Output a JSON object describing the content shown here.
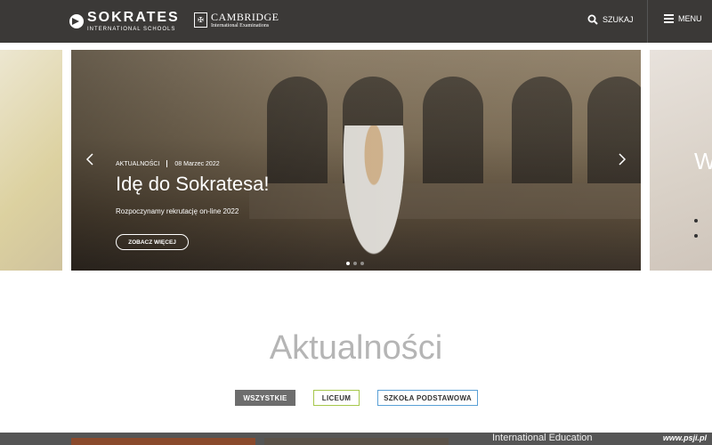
{
  "header": {
    "logo_name": "SOKRATES",
    "logo_sub": "INTERNATIONAL SCHOOLS",
    "cambridge_name": "CAMBRIDGE",
    "cambridge_sub": "International Examinations",
    "search_label": "SZUKAJ",
    "menu_label": "MENU"
  },
  "slider": {
    "category": "AKTUALNOŚCI",
    "date": "08 Marzec 2022",
    "title": "Idę do Sokratesa!",
    "subtitle": "Rozpoczynamy rekrutację on-line 2022",
    "button": "ZOBACZ WIĘCEJ",
    "right_peek_letter": "W",
    "active_dot": 1,
    "dot_count": 3
  },
  "section": {
    "title": "Aktualności",
    "filters": [
      "WSZYSTKIE",
      "LICEUM",
      "SZKOŁA PODSTAWOWA"
    ]
  },
  "bottom": {
    "card3_text": "International Education",
    "watermark": "www.psji.pl"
  },
  "colors": {
    "header_bg": "#3b3937",
    "filter_active": "#6d6d6d",
    "liceum_border": "#a6c74b",
    "szkola_border": "#5aa0d6"
  }
}
